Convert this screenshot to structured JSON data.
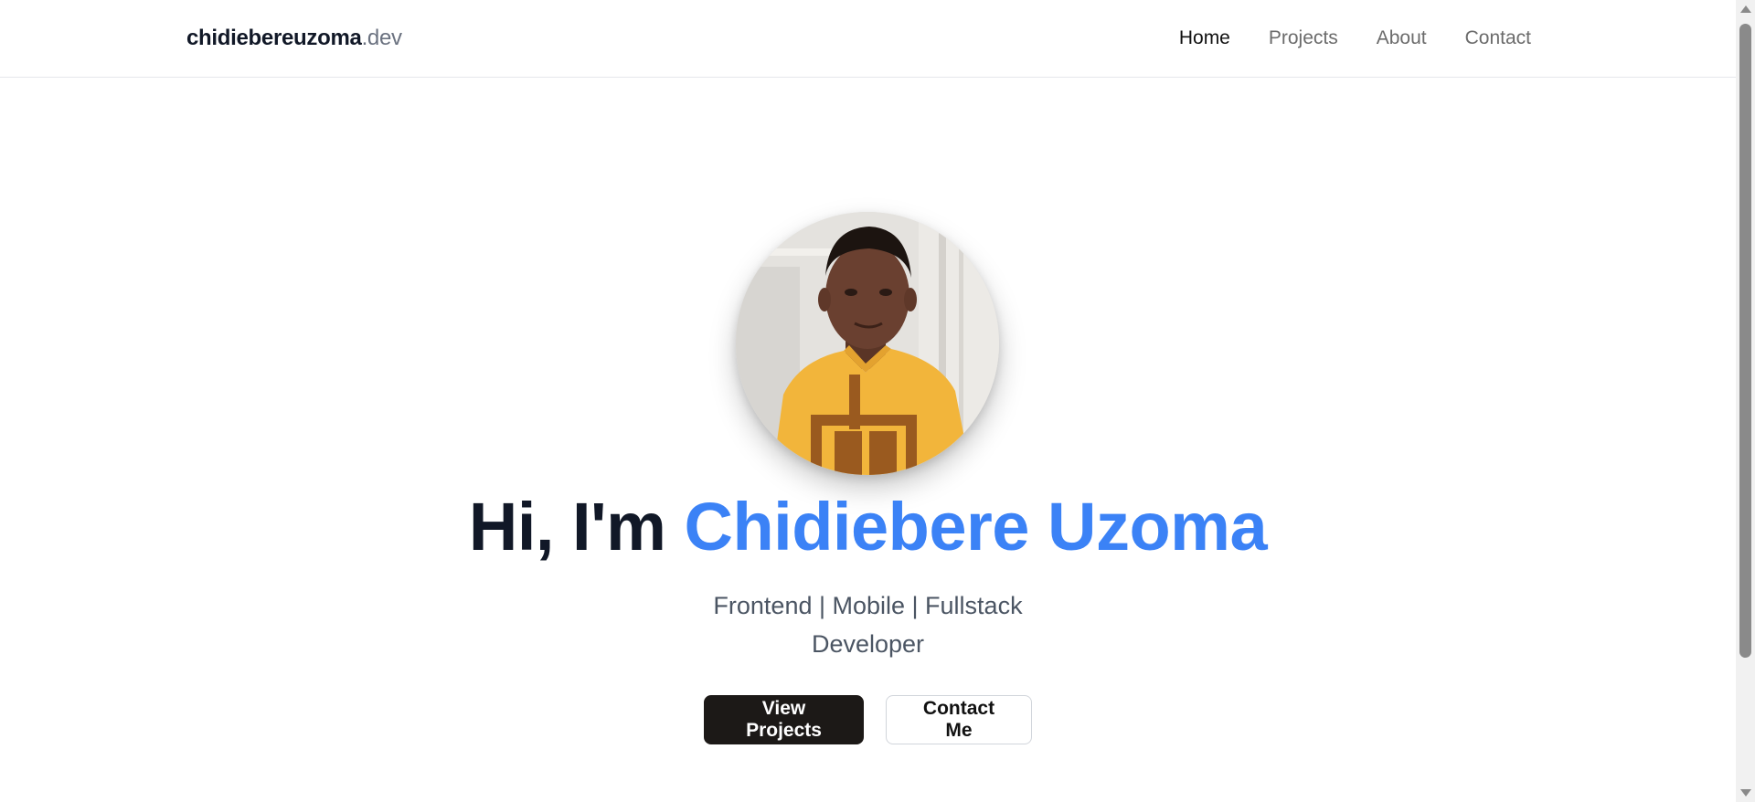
{
  "header": {
    "brand_name": "chidiebereuzoma",
    "brand_tld": ".dev",
    "nav": [
      {
        "label": "Home",
        "active": true
      },
      {
        "label": "Projects",
        "active": false
      },
      {
        "label": "About",
        "active": false
      },
      {
        "label": "Contact",
        "active": false
      }
    ]
  },
  "hero": {
    "greeting": "Hi, I'm ",
    "name": "Chidiebere Uzoma",
    "tagline_line1": "Frontend | Mobile | Fullstack",
    "tagline_line2": "Developer",
    "primary_cta": "View Projects",
    "secondary_cta": "Contact Me",
    "avatar_icon": "profile-photo"
  },
  "colors": {
    "accent": "#3b82f6",
    "heading": "#111827",
    "primary_button": "#1c1917"
  }
}
